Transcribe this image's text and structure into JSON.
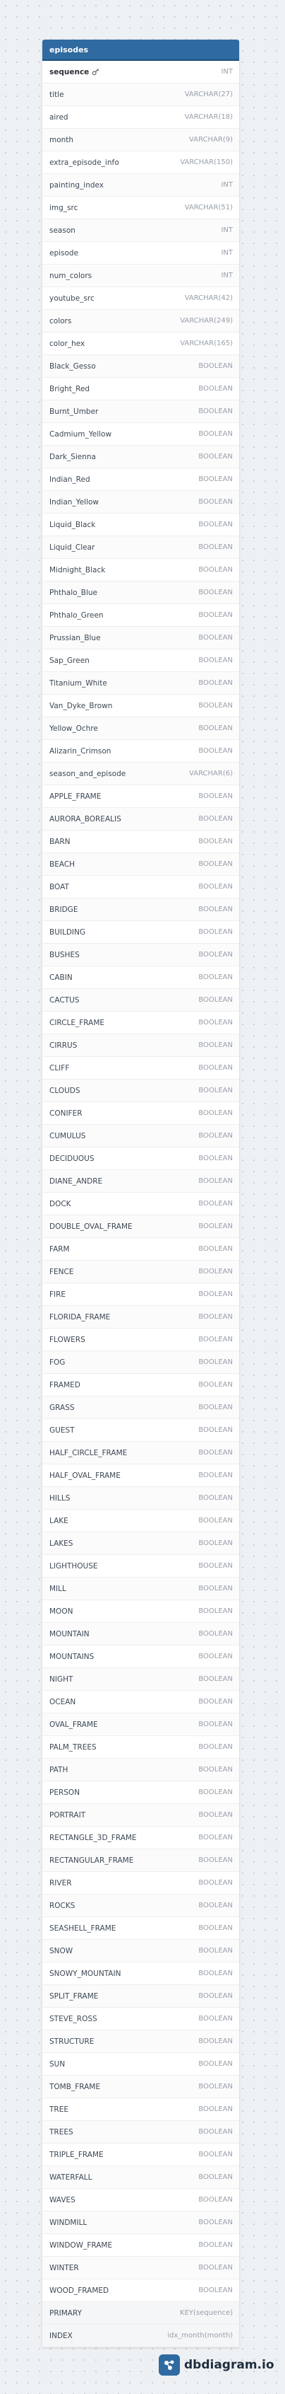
{
  "table": {
    "name": "episodes",
    "fields": [
      {
        "name": "sequence",
        "type": "INT",
        "pk": true
      },
      {
        "name": "title",
        "type": "VARCHAR(27)"
      },
      {
        "name": "aired",
        "type": "VARCHAR(18)"
      },
      {
        "name": "month",
        "type": "VARCHAR(9)"
      },
      {
        "name": "extra_episode_info",
        "type": "VARCHAR(150)"
      },
      {
        "name": "painting_index",
        "type": "INT"
      },
      {
        "name": "img_src",
        "type": "VARCHAR(51)"
      },
      {
        "name": "season",
        "type": "INT"
      },
      {
        "name": "episode",
        "type": "INT"
      },
      {
        "name": "num_colors",
        "type": "INT"
      },
      {
        "name": "youtube_src",
        "type": "VARCHAR(42)"
      },
      {
        "name": "colors",
        "type": "VARCHAR(249)"
      },
      {
        "name": "color_hex",
        "type": "VARCHAR(165)"
      },
      {
        "name": "Black_Gesso",
        "type": "BOOLEAN"
      },
      {
        "name": "Bright_Red",
        "type": "BOOLEAN"
      },
      {
        "name": "Burnt_Umber",
        "type": "BOOLEAN"
      },
      {
        "name": "Cadmium_Yellow",
        "type": "BOOLEAN"
      },
      {
        "name": "Dark_Sienna",
        "type": "BOOLEAN"
      },
      {
        "name": "Indian_Red",
        "type": "BOOLEAN"
      },
      {
        "name": "Indian_Yellow",
        "type": "BOOLEAN"
      },
      {
        "name": "Liquid_Black",
        "type": "BOOLEAN"
      },
      {
        "name": "Liquid_Clear",
        "type": "BOOLEAN"
      },
      {
        "name": "Midnight_Black",
        "type": "BOOLEAN"
      },
      {
        "name": "Phthalo_Blue",
        "type": "BOOLEAN"
      },
      {
        "name": "Phthalo_Green",
        "type": "BOOLEAN"
      },
      {
        "name": "Prussian_Blue",
        "type": "BOOLEAN"
      },
      {
        "name": "Sap_Green",
        "type": "BOOLEAN"
      },
      {
        "name": "Titanium_White",
        "type": "BOOLEAN"
      },
      {
        "name": "Van_Dyke_Brown",
        "type": "BOOLEAN"
      },
      {
        "name": "Yellow_Ochre",
        "type": "BOOLEAN"
      },
      {
        "name": "Alizarin_Crimson",
        "type": "BOOLEAN"
      },
      {
        "name": "season_and_episode",
        "type": "VARCHAR(6)"
      },
      {
        "name": "APPLE_FRAME",
        "type": "BOOLEAN"
      },
      {
        "name": "AURORA_BOREALIS",
        "type": "BOOLEAN"
      },
      {
        "name": "BARN",
        "type": "BOOLEAN"
      },
      {
        "name": "BEACH",
        "type": "BOOLEAN"
      },
      {
        "name": "BOAT",
        "type": "BOOLEAN"
      },
      {
        "name": "BRIDGE",
        "type": "BOOLEAN"
      },
      {
        "name": "BUILDING",
        "type": "BOOLEAN"
      },
      {
        "name": "BUSHES",
        "type": "BOOLEAN"
      },
      {
        "name": "CABIN",
        "type": "BOOLEAN"
      },
      {
        "name": "CACTUS",
        "type": "BOOLEAN"
      },
      {
        "name": "CIRCLE_FRAME",
        "type": "BOOLEAN"
      },
      {
        "name": "CIRRUS",
        "type": "BOOLEAN"
      },
      {
        "name": "CLIFF",
        "type": "BOOLEAN"
      },
      {
        "name": "CLOUDS",
        "type": "BOOLEAN"
      },
      {
        "name": "CONIFER",
        "type": "BOOLEAN"
      },
      {
        "name": "CUMULUS",
        "type": "BOOLEAN"
      },
      {
        "name": "DECIDUOUS",
        "type": "BOOLEAN"
      },
      {
        "name": "DIANE_ANDRE",
        "type": "BOOLEAN"
      },
      {
        "name": "DOCK",
        "type": "BOOLEAN"
      },
      {
        "name": "DOUBLE_OVAL_FRAME",
        "type": "BOOLEAN"
      },
      {
        "name": "FARM",
        "type": "BOOLEAN"
      },
      {
        "name": "FENCE",
        "type": "BOOLEAN"
      },
      {
        "name": "FIRE",
        "type": "BOOLEAN"
      },
      {
        "name": "FLORIDA_FRAME",
        "type": "BOOLEAN"
      },
      {
        "name": "FLOWERS",
        "type": "BOOLEAN"
      },
      {
        "name": "FOG",
        "type": "BOOLEAN"
      },
      {
        "name": "FRAMED",
        "type": "BOOLEAN"
      },
      {
        "name": "GRASS",
        "type": "BOOLEAN"
      },
      {
        "name": "GUEST",
        "type": "BOOLEAN"
      },
      {
        "name": "HALF_CIRCLE_FRAME",
        "type": "BOOLEAN"
      },
      {
        "name": "HALF_OVAL_FRAME",
        "type": "BOOLEAN"
      },
      {
        "name": "HILLS",
        "type": "BOOLEAN"
      },
      {
        "name": "LAKE",
        "type": "BOOLEAN"
      },
      {
        "name": "LAKES",
        "type": "BOOLEAN"
      },
      {
        "name": "LIGHTHOUSE",
        "type": "BOOLEAN"
      },
      {
        "name": "MILL",
        "type": "BOOLEAN"
      },
      {
        "name": "MOON",
        "type": "BOOLEAN"
      },
      {
        "name": "MOUNTAIN",
        "type": "BOOLEAN"
      },
      {
        "name": "MOUNTAINS",
        "type": "BOOLEAN"
      },
      {
        "name": "NIGHT",
        "type": "BOOLEAN"
      },
      {
        "name": "OCEAN",
        "type": "BOOLEAN"
      },
      {
        "name": "OVAL_FRAME",
        "type": "BOOLEAN"
      },
      {
        "name": "PALM_TREES",
        "type": "BOOLEAN"
      },
      {
        "name": "PATH",
        "type": "BOOLEAN"
      },
      {
        "name": "PERSON",
        "type": "BOOLEAN"
      },
      {
        "name": "PORTRAIT",
        "type": "BOOLEAN"
      },
      {
        "name": "RECTANGLE_3D_FRAME",
        "type": "BOOLEAN"
      },
      {
        "name": "RECTANGULAR_FRAME",
        "type": "BOOLEAN"
      },
      {
        "name": "RIVER",
        "type": "BOOLEAN"
      },
      {
        "name": "ROCKS",
        "type": "BOOLEAN"
      },
      {
        "name": "SEASHELL_FRAME",
        "type": "BOOLEAN"
      },
      {
        "name": "SNOW",
        "type": "BOOLEAN"
      },
      {
        "name": "SNOWY_MOUNTAIN",
        "type": "BOOLEAN"
      },
      {
        "name": "SPLIT_FRAME",
        "type": "BOOLEAN"
      },
      {
        "name": "STEVE_ROSS",
        "type": "BOOLEAN"
      },
      {
        "name": "STRUCTURE",
        "type": "BOOLEAN"
      },
      {
        "name": "SUN",
        "type": "BOOLEAN"
      },
      {
        "name": "TOMB_FRAME",
        "type": "BOOLEAN"
      },
      {
        "name": "TREE",
        "type": "BOOLEAN"
      },
      {
        "name": "TREES",
        "type": "BOOLEAN"
      },
      {
        "name": "TRIPLE_FRAME",
        "type": "BOOLEAN"
      },
      {
        "name": "WATERFALL",
        "type": "BOOLEAN"
      },
      {
        "name": "WAVES",
        "type": "BOOLEAN"
      },
      {
        "name": "WINDMILL",
        "type": "BOOLEAN"
      },
      {
        "name": "WINDOW_FRAME",
        "type": "BOOLEAN"
      },
      {
        "name": "WINTER",
        "type": "BOOLEAN"
      },
      {
        "name": "WOOD_FRAMED",
        "type": "BOOLEAN"
      }
    ],
    "indexes": [
      {
        "name": "PRIMARY",
        "type": "KEY(sequence)"
      },
      {
        "name": "INDEX",
        "type": "idx_month(month)"
      }
    ]
  },
  "brand": {
    "text": "dbdiagram.io",
    "icon": "dbdiagram-logo-icon",
    "color": "#2f6aa0"
  },
  "colors": {
    "header": "#2f6aa0",
    "type_text": "#98a0aa",
    "name_text": "#3d4854"
  }
}
